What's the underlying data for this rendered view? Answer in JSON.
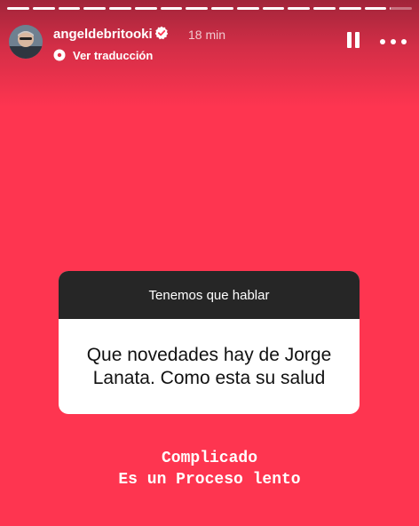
{
  "story": {
    "background_color": "#fe3550",
    "segments_total": 16,
    "segments_viewed": 15,
    "current_segment_progress": 0.05
  },
  "header": {
    "username": "angeldebritooki",
    "verified": true,
    "timestamp": "18 min",
    "translate_label": "Ver traducción",
    "icons": [
      "avatar",
      "verified-badge-icon",
      "translate-icon",
      "pause-icon",
      "more-icon"
    ]
  },
  "question_box": {
    "prompt": "Tenemos que hablar",
    "question": "Que novedades hay de Jorge Lanata. Como esta su salud"
  },
  "answer": {
    "line1": "Complicado",
    "line2": "Es un Proceso lento"
  }
}
